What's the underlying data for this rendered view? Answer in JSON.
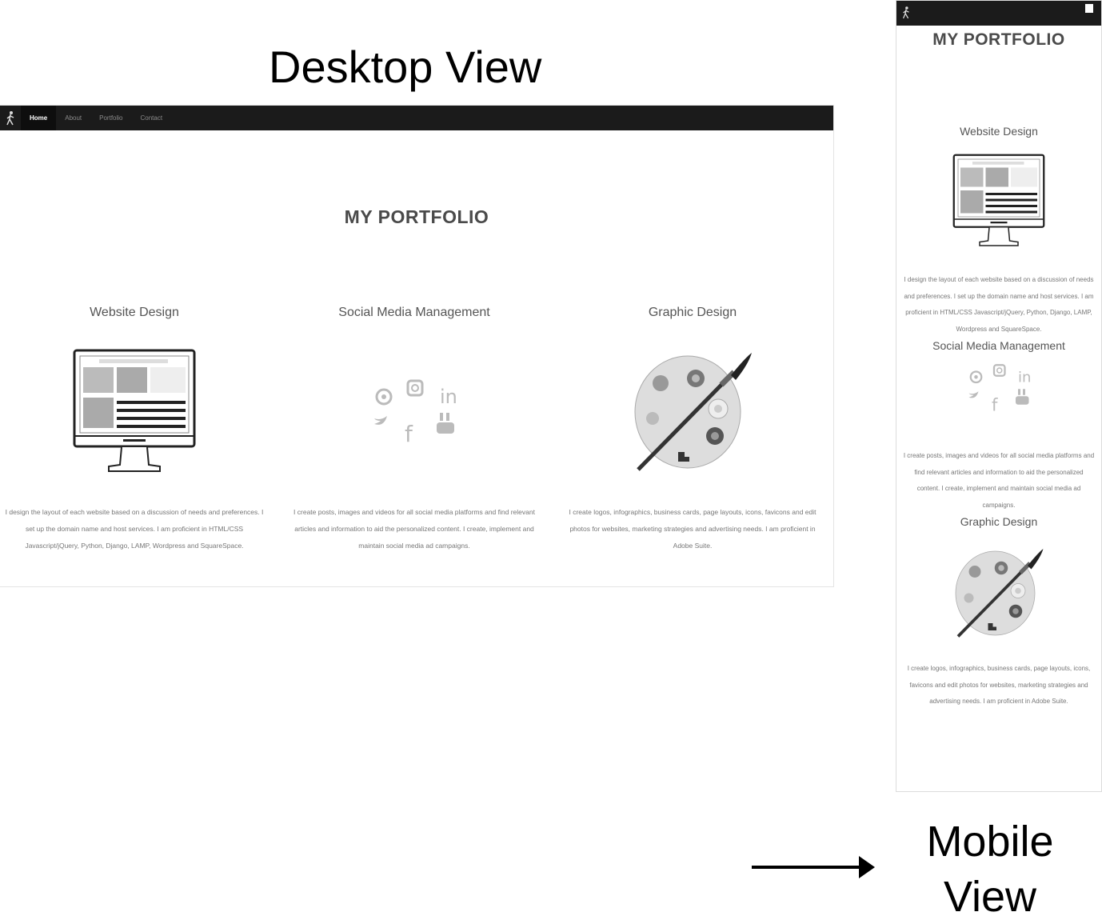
{
  "captions": {
    "desktop": "Desktop View",
    "mobile": "Mobile View"
  },
  "site": {
    "nav": {
      "items": [
        {
          "label": "Home",
          "active": true
        },
        {
          "label": "About",
          "active": false
        },
        {
          "label": "Portfolio",
          "active": false
        },
        {
          "label": "Contact",
          "active": false
        }
      ]
    },
    "title": "MY PORTFOLIO",
    "sections": [
      {
        "title": "Website Design",
        "icon": "desktop-monitor-icon",
        "text": "I design the layout of each website based on a discussion of needs and preferences. I set up the domain name and host services. I am proficient in HTML/CSS Javascript/jQuery, Python, Django, LAMP, Wordpress and SquareSpace."
      },
      {
        "title": "Social Media Management",
        "icon": "social-media-icons",
        "text": "I create posts, images and videos for all social media platforms and find relevant articles and information to aid the personalized content. I create, implement and maintain social media ad campaigns."
      },
      {
        "title": "Graphic Design",
        "icon": "paint-palette-icon",
        "text": "I create logos, infographics, business cards, page layouts, icons, favicons and edit photos for websites, marketing strategies and advertising needs. I am proficient in Adobe Suite."
      }
    ]
  },
  "colors": {
    "navbar": "#1b1b1b",
    "title": "#4a4a4a",
    "body_text": "#777777"
  }
}
